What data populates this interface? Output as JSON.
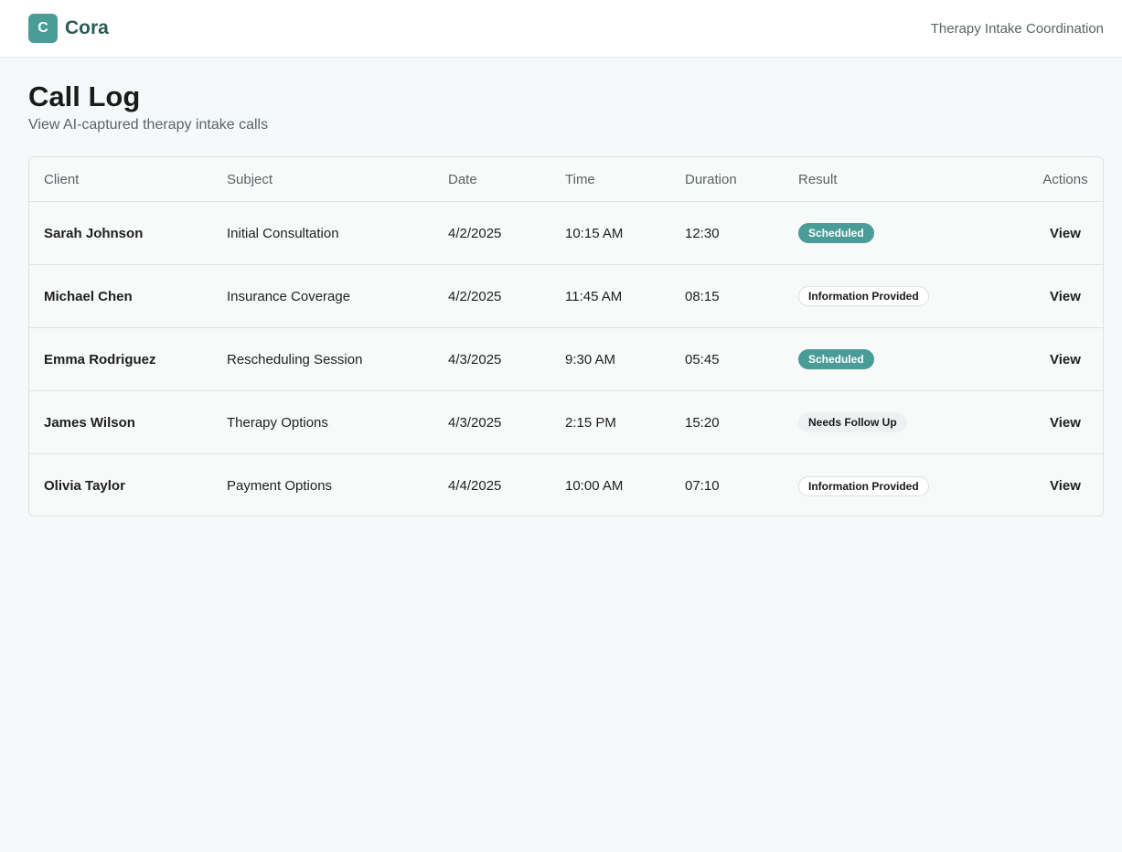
{
  "app": {
    "logo_letter": "C",
    "name": "Cora",
    "tagline": "Therapy Intake Coordination"
  },
  "page": {
    "title": "Call Log",
    "subtitle": "View AI-captured therapy intake calls"
  },
  "table": {
    "columns": [
      "Client",
      "Subject",
      "Date",
      "Time",
      "Duration",
      "Result",
      "Actions"
    ],
    "rows": [
      {
        "client": "Sarah Johnson",
        "subject": "Initial Consultation",
        "date": "4/2/2025",
        "time": "10:15 AM",
        "duration": "12:30",
        "result": "Scheduled",
        "action": "View"
      },
      {
        "client": "Michael Chen",
        "subject": "Insurance Coverage",
        "date": "4/2/2025",
        "time": "11:45 AM",
        "duration": "08:15",
        "result": "Information Provided",
        "action": "View"
      },
      {
        "client": "Emma Rodriguez",
        "subject": "Rescheduling Session",
        "date": "4/3/2025",
        "time": "9:30 AM",
        "duration": "05:45",
        "result": "Scheduled",
        "action": "View"
      },
      {
        "client": "James Wilson",
        "subject": "Therapy Options",
        "date": "4/3/2025",
        "time": "2:15 PM",
        "duration": "15:20",
        "result": "Needs Follow Up",
        "action": "View"
      },
      {
        "client": "Olivia Taylor",
        "subject": "Payment Options",
        "date": "4/4/2025",
        "time": "10:00 AM",
        "duration": "07:10",
        "result": "Information Provided",
        "action": "View"
      }
    ]
  },
  "colors": {
    "accent": "#4a9c98",
    "brand_text": "#2a5a58",
    "background": "#f6f9f9"
  }
}
